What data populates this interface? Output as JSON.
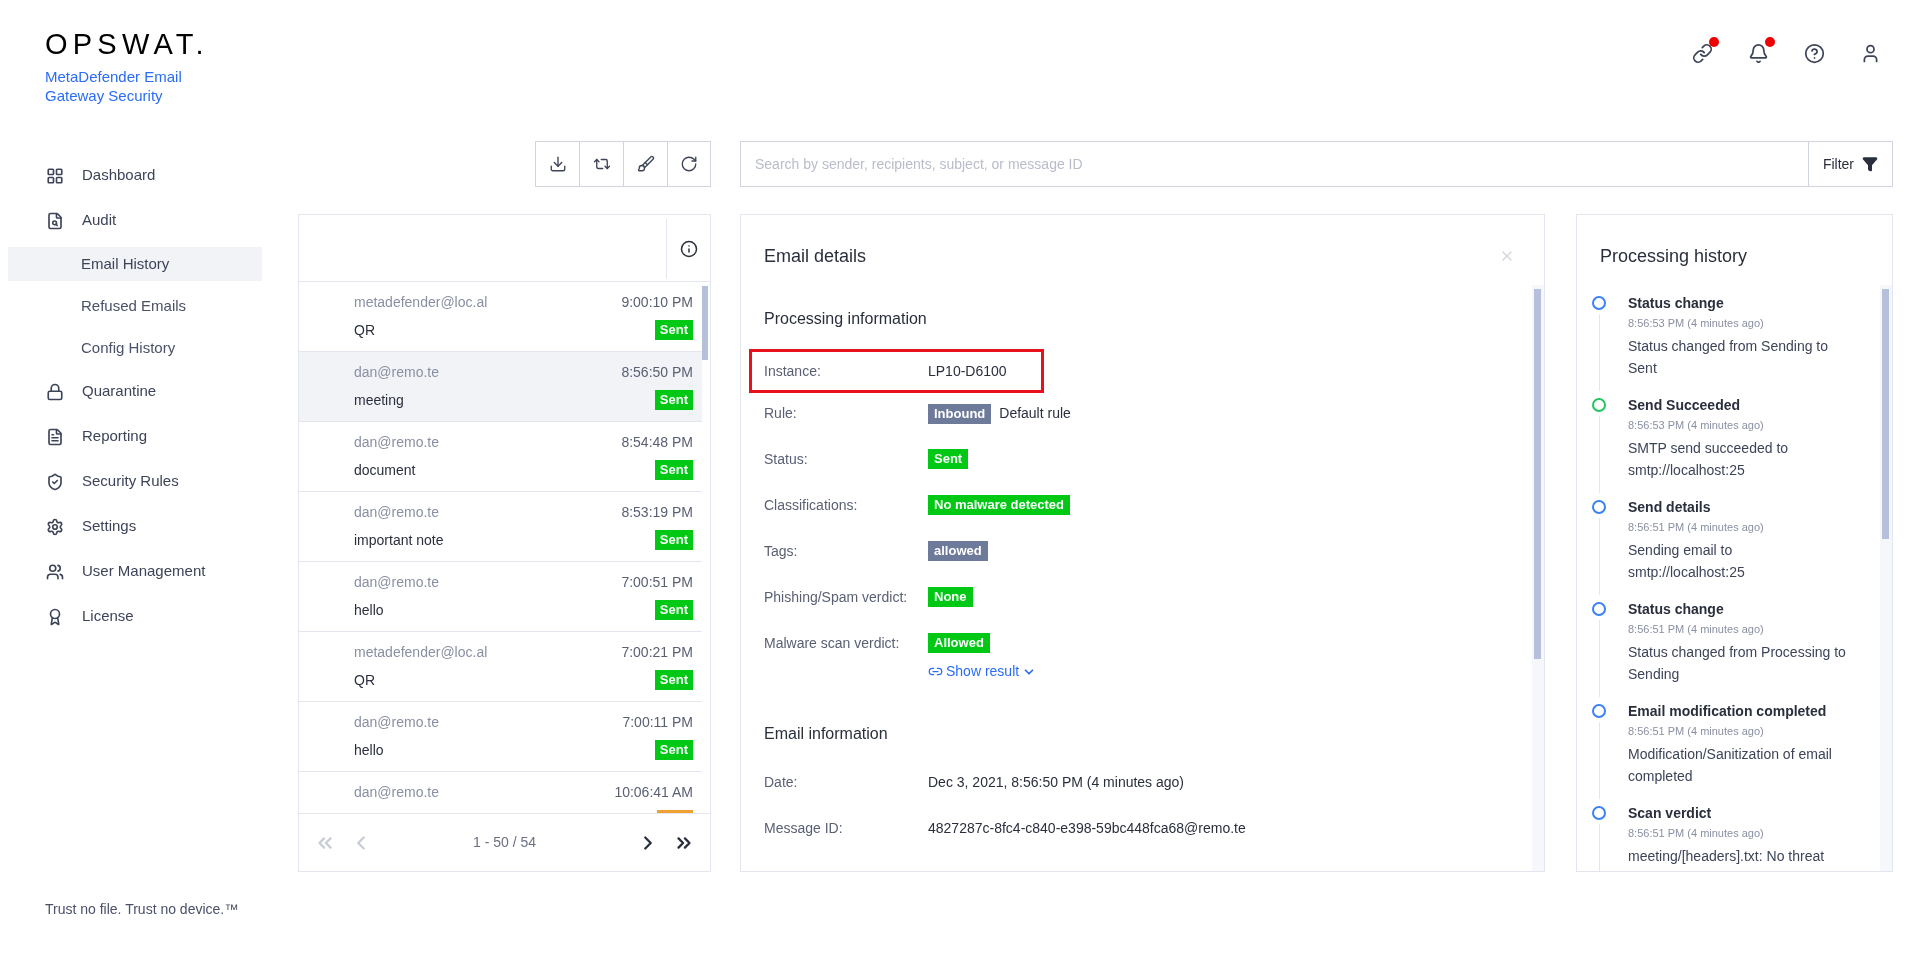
{
  "brand": {
    "logo": "OPSWAT.",
    "product": "MetaDefender Email Gateway Security"
  },
  "header": {
    "icons": [
      {
        "kind": "link",
        "alert": true
      },
      {
        "kind": "bell",
        "alert": true
      },
      {
        "kind": "help",
        "alert": false
      },
      {
        "kind": "user",
        "alert": false
      }
    ]
  },
  "sidebar": {
    "items": [
      {
        "label": "Dashboard",
        "kind": "dashboard"
      },
      {
        "label": "Audit",
        "kind": "audit",
        "children": [
          {
            "label": "Email History",
            "selected": true
          },
          {
            "label": "Refused Emails",
            "selected": false
          },
          {
            "label": "Config History",
            "selected": false
          }
        ]
      },
      {
        "label": "Quarantine",
        "kind": "quarantine"
      },
      {
        "label": "Reporting",
        "kind": "reporting"
      },
      {
        "label": "Security Rules",
        "kind": "rules"
      },
      {
        "label": "Settings",
        "kind": "settings"
      },
      {
        "label": "User Management",
        "kind": "users"
      },
      {
        "label": "License",
        "kind": "license"
      }
    ],
    "footer": "Trust no file. Trust no device.™"
  },
  "toolbar": {
    "buttons": [
      {
        "kind": "download"
      },
      {
        "kind": "sync"
      },
      {
        "kind": "clean"
      },
      {
        "kind": "refresh"
      }
    ]
  },
  "search": {
    "placeholder": "Search by sender, recipients, subject, or message ID",
    "filter": "Filter"
  },
  "email_list": {
    "rows": [
      {
        "sender": "metadefender@loc.al",
        "time": "9:00:10 PM",
        "subject": "QR",
        "status": {
          "label": "Sent",
          "kind": "success"
        },
        "selected": false
      },
      {
        "sender": "dan@remo.te",
        "time": "8:56:50 PM",
        "subject": "meeting",
        "status": {
          "label": "Sent",
          "kind": "success"
        },
        "selected": true
      },
      {
        "sender": "dan@remo.te",
        "time": "8:54:48 PM",
        "subject": "document",
        "status": {
          "label": "Sent",
          "kind": "success"
        },
        "selected": false
      },
      {
        "sender": "dan@remo.te",
        "time": "8:53:19 PM",
        "subject": "important note",
        "status": {
          "label": "Sent",
          "kind": "success"
        },
        "selected": false
      },
      {
        "sender": "dan@remo.te",
        "time": "7:00:51 PM",
        "subject": "hello",
        "status": {
          "label": "Sent",
          "kind": "success"
        },
        "selected": false
      },
      {
        "sender": "metadefender@loc.al",
        "time": "7:00:21 PM",
        "subject": "QR",
        "status": {
          "label": "Sent",
          "kind": "success"
        },
        "selected": false
      },
      {
        "sender": "dan@remo.te",
        "time": "7:00:11 PM",
        "subject": "hello",
        "status": {
          "label": "Sent",
          "kind": "success"
        },
        "selected": false
      },
      {
        "sender": "dan@remo.te",
        "time": "10:06:41 AM",
        "status": {
          "kind": "warning"
        },
        "selected": false
      }
    ],
    "pagination": {
      "range": "1 - 50 / 54",
      "first_disabled": true,
      "prev_disabled": true,
      "next_disabled": false,
      "last_disabled": false
    }
  },
  "email_details": {
    "title": "Email details",
    "sections": [
      {
        "heading": "Processing information",
        "fields": [
          {
            "label": "Instance:",
            "highlighted": true,
            "values": [
              {
                "kind": "text",
                "text": "LP10-D6100"
              }
            ]
          },
          {
            "label": "Rule:",
            "highlighted": false,
            "values": [
              {
                "kind": "tag",
                "text": "Inbound"
              },
              {
                "kind": "text",
                "text": "Default rule"
              }
            ]
          },
          {
            "label": "Status:",
            "highlighted": false,
            "values": [
              {
                "kind": "ok",
                "text": "Sent"
              }
            ]
          },
          {
            "label": "Classifications:",
            "highlighted": false,
            "values": [
              {
                "kind": "ok",
                "text": "No malware detected"
              }
            ]
          },
          {
            "label": "Tags:",
            "highlighted": false,
            "values": [
              {
                "kind": "tag",
                "text": "allowed"
              }
            ]
          },
          {
            "label": "Phishing/Spam verdict:",
            "highlighted": false,
            "values": [
              {
                "kind": "ok",
                "text": "None"
              }
            ]
          },
          {
            "label": "Malware scan verdict:",
            "highlighted": false,
            "values": [
              {
                "kind": "ok",
                "text": "Allowed"
              }
            ],
            "link": "Show result"
          }
        ]
      },
      {
        "heading": "Email information",
        "fields": [
          {
            "label": "Date:",
            "highlighted": false,
            "values": [
              {
                "kind": "text",
                "text": "Dec 3, 2021, 8:56:50 PM (4 minutes ago)"
              }
            ]
          },
          {
            "label": "Message ID:",
            "highlighted": false,
            "values": [
              {
                "kind": "text",
                "text": "4827287c-8fc4-c840-e398-59bc448fca68@remo.te"
              }
            ]
          }
        ]
      }
    ]
  },
  "processing_history": {
    "title": "Processing history",
    "events": [
      {
        "title": "Status change",
        "time": "8:56:53 PM (4 minutes ago)",
        "description": "Status changed from Sending to Sent",
        "color": "#3b82f6"
      },
      {
        "title": "Send Succeeded",
        "time": "8:56:53 PM (4 minutes ago)",
        "description": "SMTP send succeeded to smtp://localhost:25",
        "color": "#22c55e"
      },
      {
        "title": "Send details",
        "time": "8:56:51 PM (4 minutes ago)",
        "description": "Sending email to smtp://localhost:25",
        "color": "#3b82f6"
      },
      {
        "title": "Status change",
        "time": "8:56:51 PM (4 minutes ago)",
        "description": "Status changed from Processing to Sending",
        "color": "#3b82f6"
      },
      {
        "title": "Email modification completed",
        "time": "8:56:51 PM (4 minutes ago)",
        "description": "Modification/Sanitization of email completed",
        "color": "#3b82f6"
      },
      {
        "title": "Scan verdict",
        "time": "8:56:51 PM (4 minutes ago)",
        "description": "meeting/[headers].txt: No threat",
        "color": "#3b82f6"
      }
    ]
  }
}
